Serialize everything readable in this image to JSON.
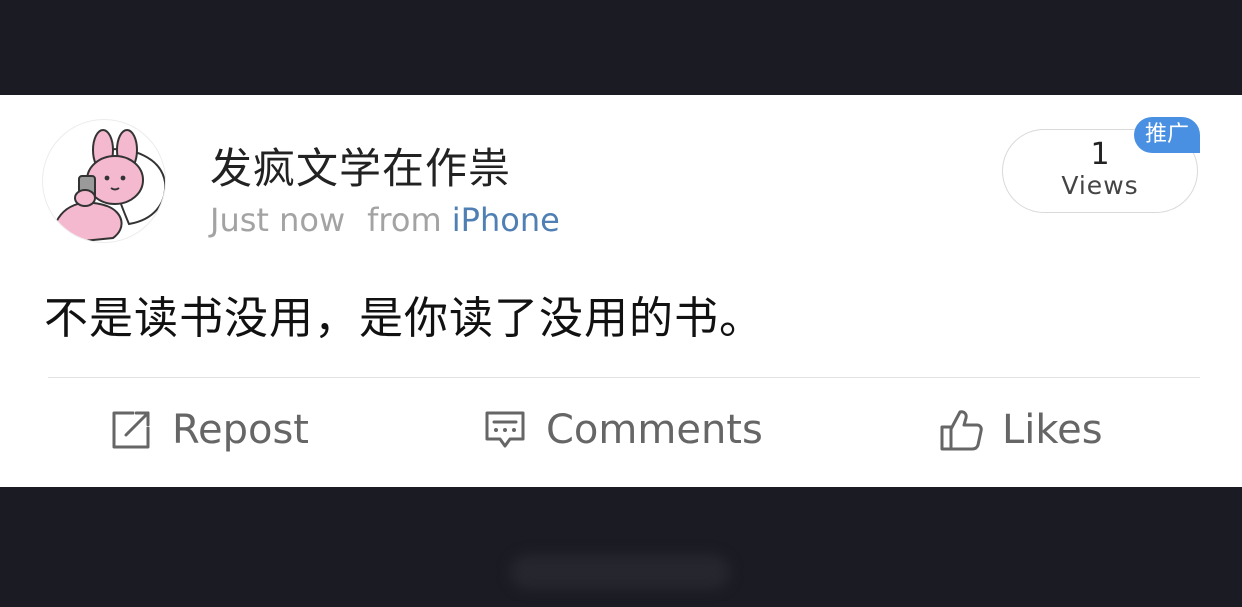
{
  "post": {
    "username": "发疯文学在作祟",
    "time": "Just now",
    "from_label": "from",
    "source": "iPhone",
    "text": "不是读书没用，是你读了没用的书。",
    "views": {
      "count": "1",
      "label": "Views"
    },
    "promo_badge": "推广"
  },
  "actions": {
    "repost": "Repost",
    "comments": "Comments",
    "likes": "Likes"
  },
  "icons": {
    "avatar": "pink-bunny-avatar",
    "repost": "repost-icon",
    "comments": "comment-icon",
    "likes": "thumbs-up-icon"
  },
  "colors": {
    "background": "#1b1b23",
    "card": "#ffffff",
    "source_link": "#4f7fb3",
    "badge": "#4a90e2",
    "meta_text": "#a3a3a3",
    "action_text": "#666666"
  }
}
